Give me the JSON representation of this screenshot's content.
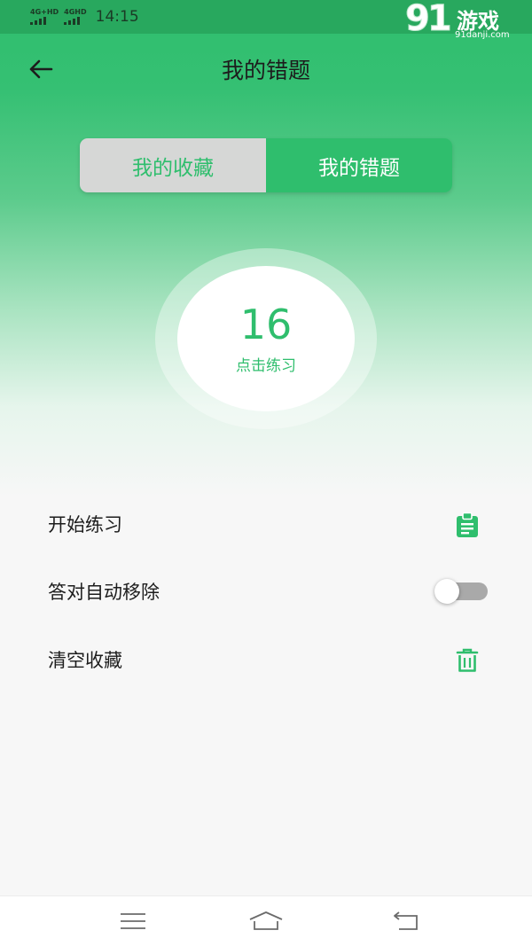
{
  "status_bar": {
    "network_1": "4G+HD",
    "network_2": "4GHD",
    "time": "14:15"
  },
  "watermark": {
    "brand_number": "91",
    "brand_text": "游戏",
    "url": "91danji.com"
  },
  "header": {
    "back_icon": "arrow-left-icon",
    "title": "我的错题"
  },
  "segmented_control": {
    "options": [
      "我的收藏",
      "我的错题"
    ],
    "selected": "我的错题"
  },
  "practice_circle": {
    "count": "16",
    "label": "点击练习"
  },
  "menu": {
    "items": [
      {
        "label": "开始练习",
        "icon": "clipboard-icon"
      },
      {
        "label": "答对自动移除",
        "control": "toggle",
        "toggle_on": false
      },
      {
        "label": "清空收藏",
        "icon": "trash-icon"
      }
    ]
  },
  "system_nav": {
    "buttons": [
      "menu-icon",
      "home-icon",
      "back-icon"
    ]
  },
  "colors": {
    "accent": "#2fbe6d",
    "status_bar": "#28a85e",
    "segment_inactive": "#d6d7d6",
    "toggle_track": "#a9a9a9"
  }
}
